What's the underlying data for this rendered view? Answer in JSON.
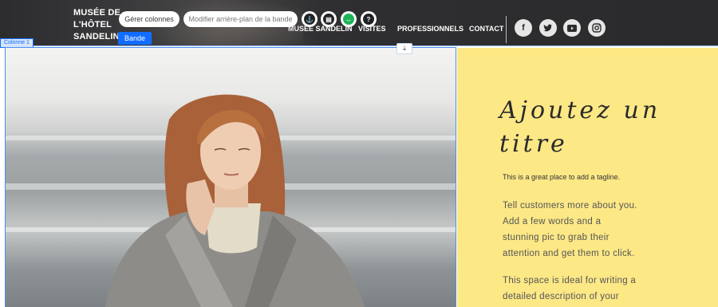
{
  "header": {
    "logo_lines": [
      "MUSÉE DE",
      "L'HÔTEL",
      "SANDELIN"
    ],
    "nav": [
      "MUSÉE SANDELIN",
      "VISITES",
      "PROFESSIONNELS",
      "CONTACT"
    ],
    "social_icons": [
      "facebook-icon",
      "twitter-icon",
      "youtube-icon",
      "instagram-icon"
    ]
  },
  "editor": {
    "manage_columns": "Gérer colonnes",
    "change_background": "Modifier arrière-plan de la bande",
    "band_label": "Bande",
    "column_label": "Colonne 1",
    "tools": [
      "anchor-icon",
      "layout-icon",
      "stretch-icon",
      "help-icon"
    ]
  },
  "panel": {
    "title": "Ajoutez un titre",
    "tagline": "This is a great place to add a tagline.",
    "paragraph1_lines": [
      "Tell customers more about you.",
      "Add a few words and a",
      "stunning pic to grab their",
      "attention and get them to click."
    ],
    "paragraph2_lines": [
      "This space is ideal for writing a",
      "detailed description of your"
    ]
  },
  "colors": {
    "accent": "#116dff",
    "panel_bg": "#fde886",
    "header_bg": "#2c2c2e"
  }
}
